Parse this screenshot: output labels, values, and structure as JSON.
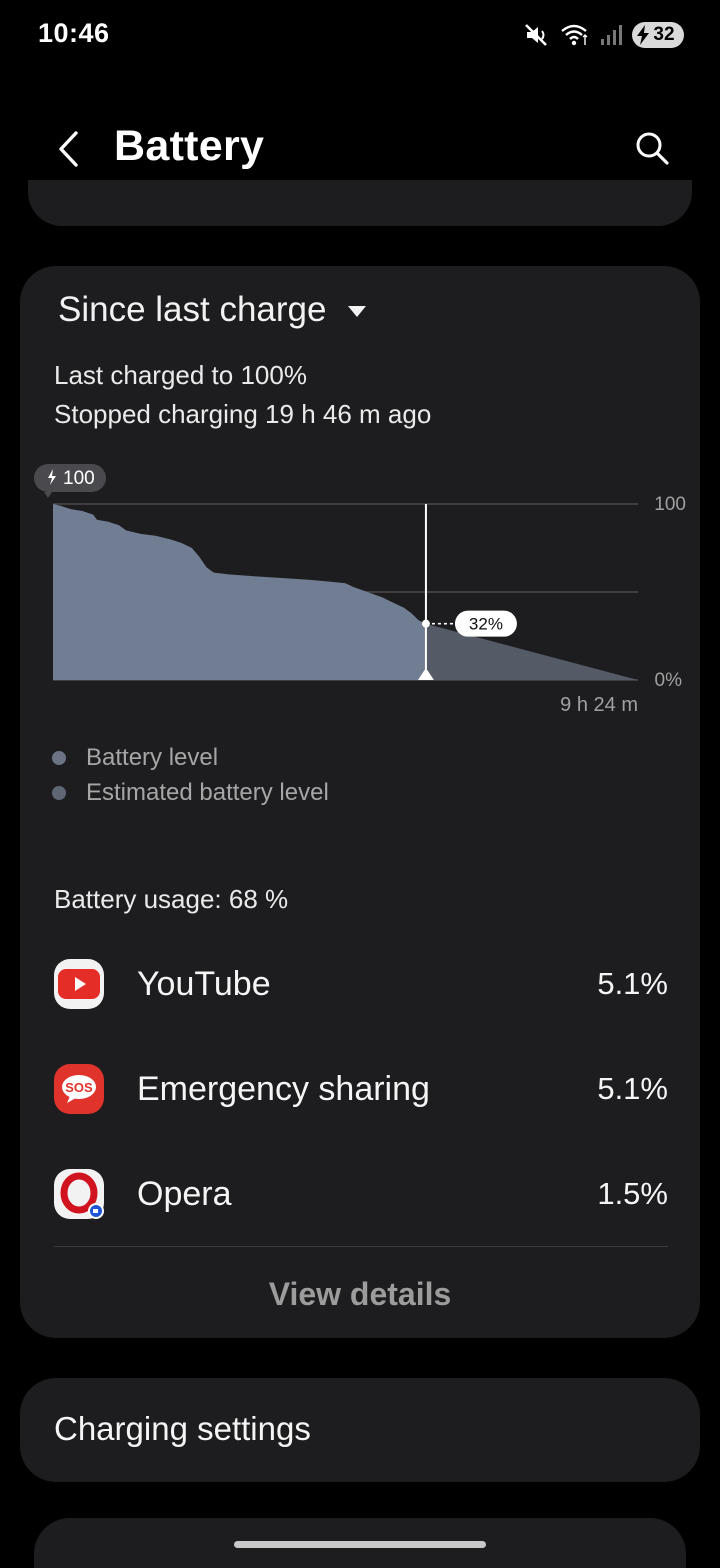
{
  "status_bar": {
    "time": "10:46",
    "battery_level": "32",
    "icons": [
      "mute-icon",
      "wifi-icon",
      "signal-icon",
      "battery-icon"
    ]
  },
  "header": {
    "title": "Battery"
  },
  "summary_card": {
    "period_label": "Since last charge",
    "last_charged": "Last charged to 100%",
    "stopped_charging": "Stopped charging 19 h 46 m ago"
  },
  "chart_data": {
    "type": "area",
    "start_badge": "100",
    "y_max_label": "100",
    "y_min_label": "0%",
    "x_end_label": "9 h 24 m",
    "current_value_label": "32%",
    "current_level": 32,
    "ylim": [
      0,
      100
    ],
    "series": [
      {
        "name": "Battery level",
        "color": "#717d92",
        "points": [
          [
            0,
            100
          ],
          [
            2,
            99
          ],
          [
            5,
            97
          ],
          [
            8,
            96
          ],
          [
            11,
            94
          ],
          [
            12,
            91
          ],
          [
            15,
            90
          ],
          [
            18,
            88
          ],
          [
            20,
            85
          ],
          [
            24,
            83
          ],
          [
            28,
            82
          ],
          [
            32,
            80
          ],
          [
            35,
            78
          ],
          [
            38,
            75
          ],
          [
            40,
            70
          ],
          [
            42,
            64
          ],
          [
            44,
            61
          ],
          [
            48,
            60
          ],
          [
            55,
            59
          ],
          [
            62,
            58
          ],
          [
            70,
            57
          ],
          [
            75,
            56
          ],
          [
            80,
            55
          ],
          [
            82,
            53
          ],
          [
            86,
            50
          ],
          [
            90,
            47
          ],
          [
            93,
            44
          ],
          [
            96,
            41
          ],
          [
            98,
            38
          ],
          [
            100,
            34
          ],
          [
            102,
            32
          ]
        ]
      },
      {
        "name": "Estimated battery level",
        "color": "#545a66",
        "points": [
          [
            102,
            32
          ],
          [
            160,
            0
          ]
        ]
      }
    ],
    "x_total": 160
  },
  "legend": [
    {
      "label": "Battery level",
      "color": "#6b7384"
    },
    {
      "label": "Estimated battery level",
      "color": "#5f6673"
    }
  ],
  "usage": {
    "label": "Battery usage: 68 %",
    "apps": [
      {
        "name": "YouTube",
        "percent": "5.1%",
        "icon": "youtube-icon"
      },
      {
        "name": "Emergency sharing",
        "percent": "5.1%",
        "icon": "sos-icon",
        "icon_text": "SOS"
      },
      {
        "name": "Opera",
        "percent": "1.5%",
        "icon": "opera-icon"
      }
    ],
    "view_details": "View details"
  },
  "charging": {
    "label": "Charging settings"
  }
}
